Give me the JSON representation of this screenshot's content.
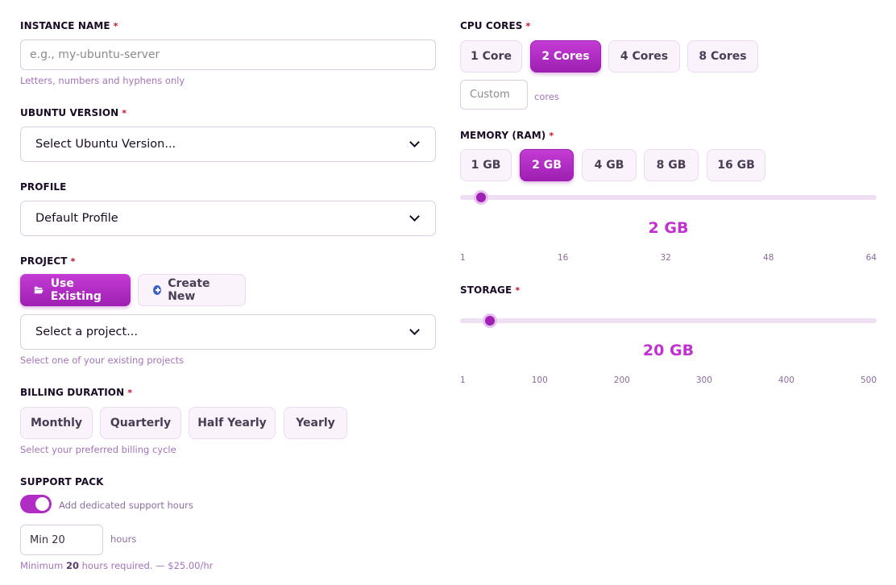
{
  "instance_name": {
    "label": "INSTANCE NAME",
    "required_mark": "*",
    "placeholder": "e.g., my-ubuntu-server",
    "hint": "Letters, numbers and hyphens only"
  },
  "ubuntu_version": {
    "label": "UBUNTU VERSION",
    "required_mark": "*",
    "selected": "Select Ubuntu Version..."
  },
  "profile": {
    "label": "PROFILE",
    "selected": "Default Profile"
  },
  "project": {
    "label": "PROJECT",
    "required_mark": "*",
    "use_existing_label": "Use Existing",
    "create_new_label": "Create New",
    "selected": "Select a project...",
    "hint": "Select one of your existing projects"
  },
  "billing": {
    "label": "BILLING DURATION",
    "required_mark": "*",
    "options": [
      "Monthly",
      "Quarterly",
      "Half Yearly",
      "Yearly"
    ],
    "hint": "Select your preferred billing cycle"
  },
  "support": {
    "label": "SUPPORT PACK",
    "toggle_label": "Add dedicated support hours",
    "toggle_on": true,
    "hours_value": "Min 20",
    "hours_unit": "hours",
    "note_prefix": "Minimum",
    "note_hours": "20",
    "note_suffix": "hours required. — $25.00/hr"
  },
  "cpu": {
    "label": "CPU CORES",
    "required_mark": "*",
    "options": [
      "1 Core",
      "2 Cores",
      "4 Cores",
      "8 Cores"
    ],
    "selected_index": 1,
    "custom_placeholder": "Custom",
    "custom_unit": "cores"
  },
  "memory": {
    "label": "MEMORY (RAM)",
    "required_mark": "*",
    "options": [
      "1 GB",
      "2 GB",
      "4 GB",
      "8 GB",
      "16 GB"
    ],
    "selected_index": 1,
    "value_display": "2 GB",
    "slider_min": 1,
    "slider_max": 64,
    "slider_value": 2,
    "ticks": [
      "1",
      "16",
      "32",
      "48",
      "64"
    ]
  },
  "storage": {
    "label": "STORAGE",
    "required_mark": "*",
    "value_display": "20 GB",
    "slider_min": 1,
    "slider_max": 500,
    "slider_value": 20,
    "ticks": [
      "1",
      "100",
      "200",
      "300",
      "400",
      "500"
    ]
  },
  "colors": {
    "accent": "#a020b5",
    "accent_text": "#c031cf",
    "required": "#c8102e",
    "hint": "#a474b8"
  }
}
